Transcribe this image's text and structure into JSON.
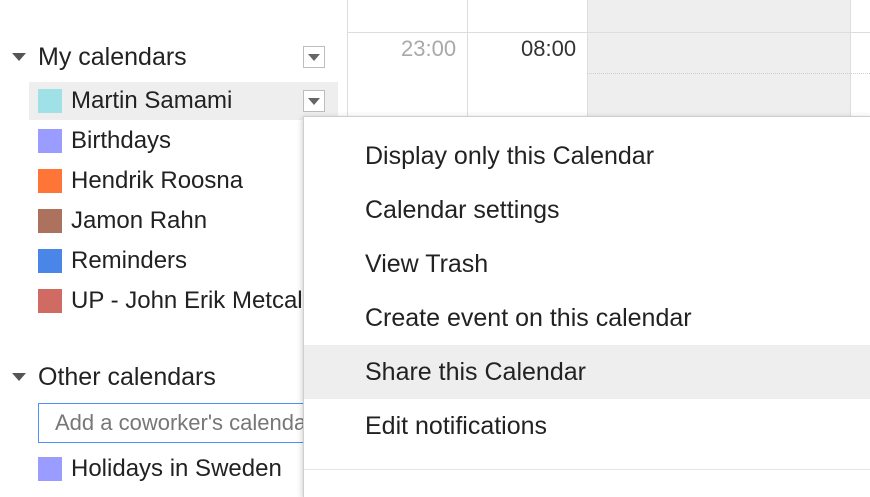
{
  "calendar_grid": {
    "times": [
      "23:00",
      "08:00"
    ]
  },
  "my_calendars": {
    "title": "My calendars",
    "items": [
      {
        "label": "Martin Samami",
        "color": "#9fe1e7"
      },
      {
        "label": "Birthdays",
        "color": "#9a9cff"
      },
      {
        "label": "Hendrik Roosna",
        "color": "#ff7537"
      },
      {
        "label": "Jamon Rahn",
        "color": "#ac725e"
      },
      {
        "label": "Reminders",
        "color": "#4986e7"
      },
      {
        "label": "UP - John Erik Metcalf",
        "color": "#d06b64"
      }
    ]
  },
  "other_calendars": {
    "title": "Other calendars",
    "add_placeholder": "Add a coworker's calendar",
    "items": [
      {
        "label": "Holidays in Sweden",
        "color": "#9a9cff"
      }
    ]
  },
  "context_menu": {
    "items": [
      "Display only this Calendar",
      "Calendar settings",
      "View Trash",
      "Create event on this calendar",
      "Share this Calendar",
      "Edit notifications"
    ],
    "highlighted_index": 4
  }
}
